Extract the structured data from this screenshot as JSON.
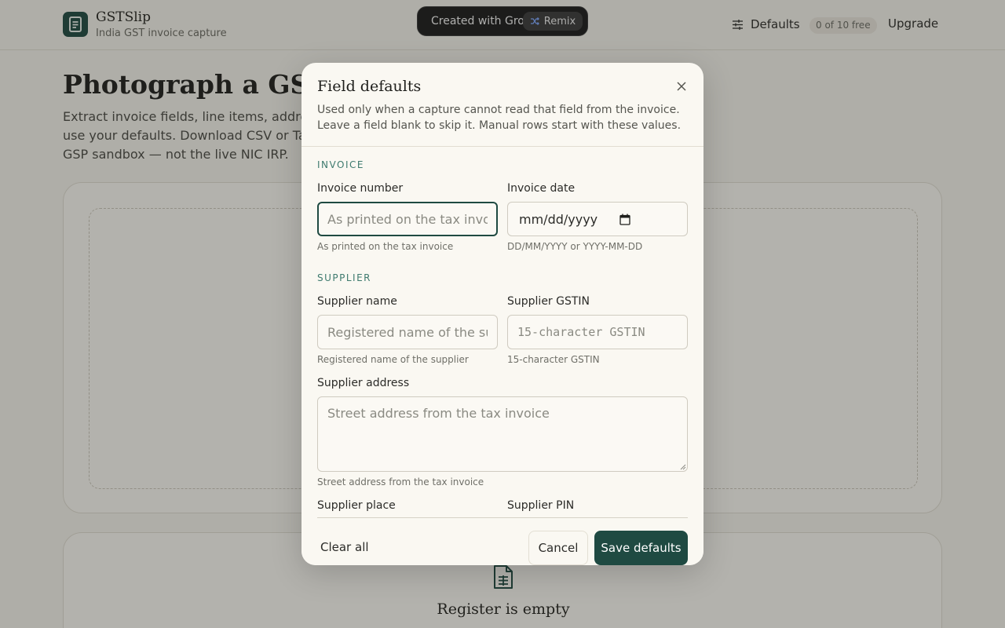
{
  "header": {
    "app_name": "GSTSlip",
    "tagline": "India GST invoice capture",
    "defaults_label": "Defaults",
    "quota_badge": "0 of 10 free",
    "upgrade_label": "Upgrade"
  },
  "grok_banner": {
    "text": "Created with Grok",
    "remix_label": "Remix"
  },
  "main": {
    "title": "Photograph a GST inv",
    "intro_lines": [
      "Extract invoice fields, line items, addresse",
      "use your defaults. Download CSV or Tally",
      "GSP sandbox — not the live NIC IRP."
    ],
    "register_empty": "Register is empty"
  },
  "modal": {
    "title": "Field defaults",
    "description_lines": [
      "Used only when a capture cannot read that field from the invoice.",
      "Leave a field blank to skip it. Manual rows start with these values."
    ],
    "sections": {
      "invoice": "INVOICE",
      "supplier": "SUPPLIER"
    },
    "fields": {
      "invoice_number": {
        "label": "Invoice number",
        "placeholder": "As printed on the tax invoice",
        "hint": "As printed on the tax invoice",
        "value": ""
      },
      "invoice_date": {
        "label": "Invoice date",
        "placeholder": "mm/dd/yyyy",
        "hint": "DD/MM/YYYY or YYYY-MM-DD"
      },
      "supplier_name": {
        "label": "Supplier name",
        "placeholder": "Registered name of the supplier",
        "hint": "Registered name of the supplier",
        "value": ""
      },
      "supplier_gstin": {
        "label": "Supplier GSTIN",
        "placeholder": "15-character GSTIN",
        "hint": "15-character GSTIN",
        "value": ""
      },
      "supplier_address": {
        "label": "Supplier address",
        "placeholder": "Street address from the tax invoice",
        "hint": "Street address from the tax invoice"
      },
      "supplier_place": {
        "label": "Supplier place"
      },
      "supplier_pin": {
        "label": "Supplier PIN"
      }
    },
    "buttons": {
      "clear_all": "Clear all",
      "cancel": "Cancel",
      "save": "Save defaults"
    }
  },
  "colors": {
    "accent": "#1f4a42",
    "section_label": "#3e7a6e",
    "background": "#f4f2ea"
  }
}
